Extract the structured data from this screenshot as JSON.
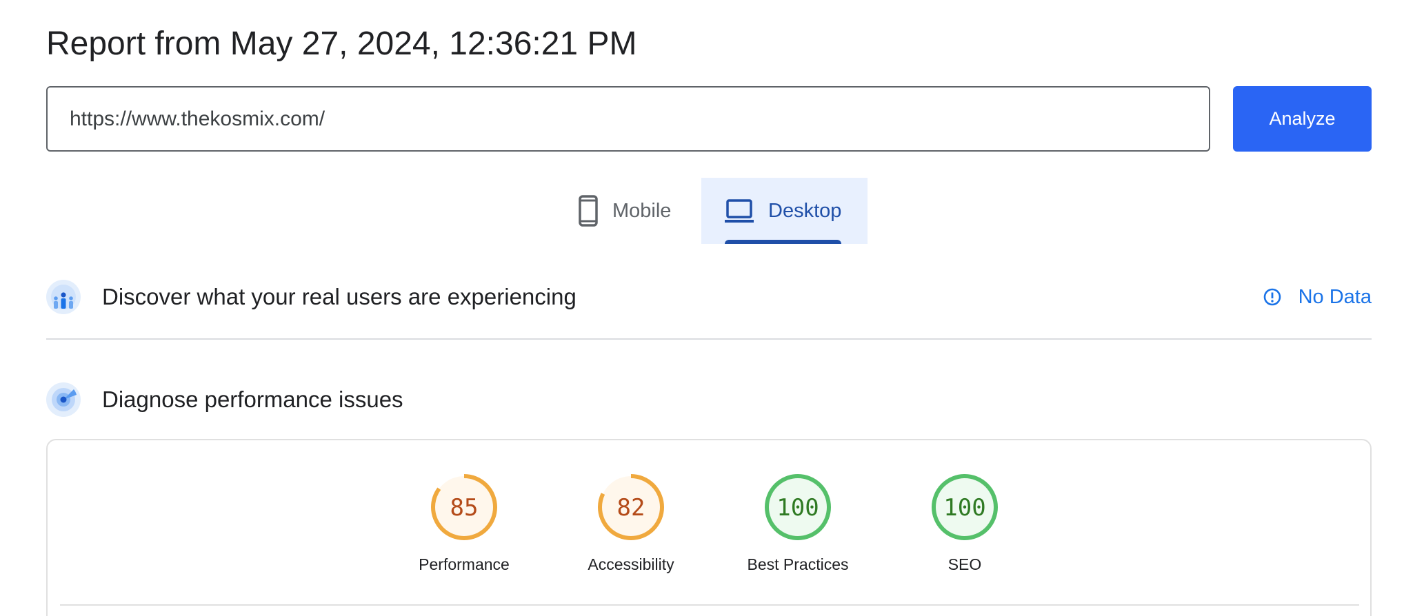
{
  "report": {
    "title": "Report from May 27, 2024, 12:36:21 PM"
  },
  "url_bar": {
    "value": "https://www.thekosmix.com/",
    "analyze_label": "Analyze"
  },
  "device_tabs": [
    {
      "label": "Mobile",
      "icon": "smartphone-icon",
      "selected": false
    },
    {
      "label": "Desktop",
      "icon": "laptop-icon",
      "selected": true
    }
  ],
  "crux_section": {
    "title": "Discover what your real users are experiencing",
    "status_label": "No Data",
    "icon": "users-globe-icon"
  },
  "diagnose_section": {
    "title": "Diagnose performance issues",
    "icon": "radar-icon"
  },
  "scores": [
    {
      "label": "Performance",
      "value": 85,
      "rating": "average"
    },
    {
      "label": "Accessibility",
      "value": 82,
      "rating": "average"
    },
    {
      "label": "Best Practices",
      "value": 100,
      "rating": "pass"
    },
    {
      "label": "SEO",
      "value": 100,
      "rating": "pass"
    }
  ],
  "colors": {
    "accent": "#2a65f4",
    "link": "#1a73e8",
    "average_ring": "#f0a93e",
    "average_fill": "#fff7ec",
    "average_text": "#b44b19",
    "pass_ring": "#55c06a",
    "pass_fill": "#eefaf0",
    "pass_text": "#2f7a23"
  }
}
